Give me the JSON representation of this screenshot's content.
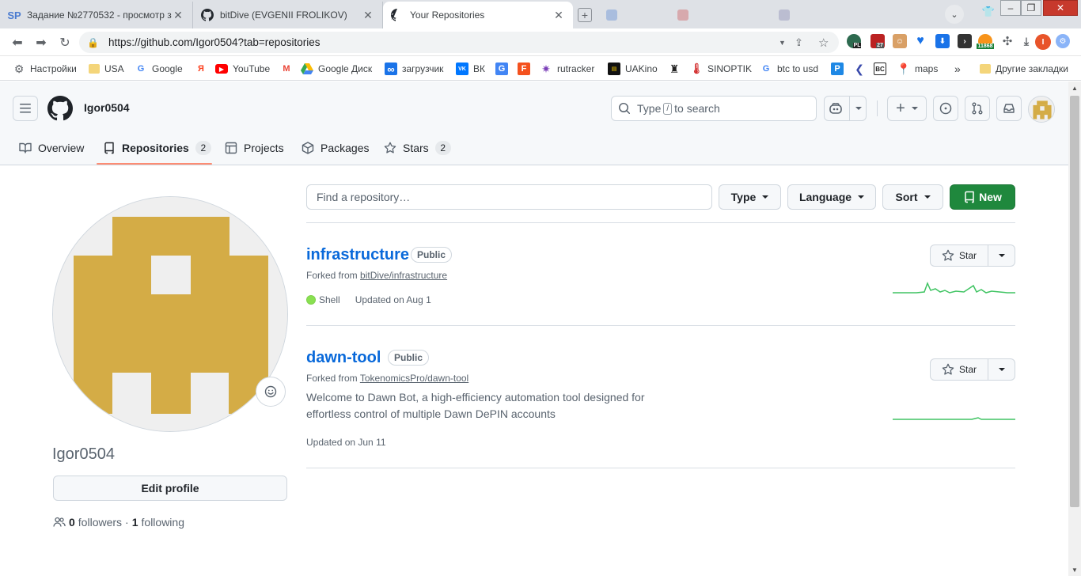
{
  "browser": {
    "tabs": [
      {
        "title": "Задание №2770532 - просмотр з",
        "favicon": "SP"
      },
      {
        "title": "bitDive (EVGENII FROLIKOV)",
        "favicon": "github-icon"
      },
      {
        "title": "Your Repositories",
        "favicon": "github-icon"
      }
    ],
    "url": "https://github.com/Igor0504?tab=repositories",
    "profile_initial": "I",
    "extension_badges": {
      "pl": "PL",
      "calendar": "27",
      "bitcoin": "11868"
    },
    "bookmarks": [
      {
        "label": "Настройки",
        "icon": "gear-icon"
      },
      {
        "label": "USA",
        "icon": "folder-icon"
      },
      {
        "label": "Google",
        "icon": "google-icon"
      },
      {
        "label": "",
        "icon": "yandex-icon",
        "glyph": "Я"
      },
      {
        "label": "YouTube",
        "icon": "youtube-icon"
      },
      {
        "label": "",
        "icon": "gmail-icon",
        "glyph": "M"
      },
      {
        "label": "Google Диск",
        "icon": "drive-icon"
      },
      {
        "label": "загрузчик",
        "icon": "infinity-icon",
        "glyph": "∞"
      },
      {
        "label": "ВК",
        "icon": "vk-icon",
        "glyph": "VK"
      },
      {
        "label": "",
        "icon": "translate-icon",
        "glyph": "G"
      },
      {
        "label": "",
        "icon": "f-icon",
        "glyph": "F"
      },
      {
        "label": "rutracker",
        "icon": "rutracker-icon"
      },
      {
        "label": "UAKino",
        "icon": "uakino-icon"
      },
      {
        "label": "",
        "icon": "figure-icon"
      },
      {
        "label": "SINOPTIK",
        "icon": "thermometer-icon"
      },
      {
        "label": "btc to usd",
        "icon": "google-icon"
      },
      {
        "label": "",
        "icon": "p-icon",
        "glyph": "P"
      },
      {
        "label": "",
        "icon": "arrow-icon"
      },
      {
        "label": "",
        "icon": "bc-icon",
        "glyph": "BC"
      },
      {
        "label": "maps",
        "icon": "maps-icon"
      }
    ],
    "more_bookmarks": "»",
    "other_bookmarks": "Другие закладки"
  },
  "header": {
    "username": "Igor0504",
    "search_prefix": "Type",
    "search_key": "/",
    "search_suffix": "to search"
  },
  "profile_nav": [
    {
      "label": "Overview",
      "icon": "book-icon",
      "count": null
    },
    {
      "label": "Repositories",
      "icon": "repo-icon",
      "count": "2",
      "selected": true
    },
    {
      "label": "Projects",
      "icon": "table-icon",
      "count": null
    },
    {
      "label": "Packages",
      "icon": "package-icon",
      "count": null
    },
    {
      "label": "Stars",
      "icon": "star-icon",
      "count": "2"
    }
  ],
  "profile": {
    "login": "Igor0504",
    "edit_label": "Edit profile",
    "followers_count": "0",
    "followers_label": "followers",
    "separator": "·",
    "following_count": "1",
    "following_label": "following"
  },
  "filters": {
    "search_placeholder": "Find a repository…",
    "type_label": "Type",
    "language_label": "Language",
    "sort_label": "Sort",
    "new_label": "New"
  },
  "repos": [
    {
      "name": "infrastructure",
      "visibility": "Public",
      "forked_prefix": "Forked from",
      "forked_from": "bitDive/infrastructure",
      "description": "",
      "language": "Shell",
      "language_color": "#89e051",
      "updated": "Updated on Aug 1",
      "star_label": "Star"
    },
    {
      "name": "dawn-tool",
      "visibility": "Public",
      "forked_prefix": "Forked from",
      "forked_from": "TokenomicsPro/dawn-tool",
      "description": "Welcome to Dawn Bot, a high-efficiency automation tool designed for effortless control of multiple Dawn DePIN accounts",
      "language": "",
      "updated": "Updated on Jun 11",
      "star_label": "Star"
    }
  ],
  "colors": {
    "accent": "#0969da",
    "new_button": "#1f883d",
    "nav_underline": "#fd8c73",
    "avatar_identicon": "#d4ac46",
    "sparkline": "#40c463"
  }
}
